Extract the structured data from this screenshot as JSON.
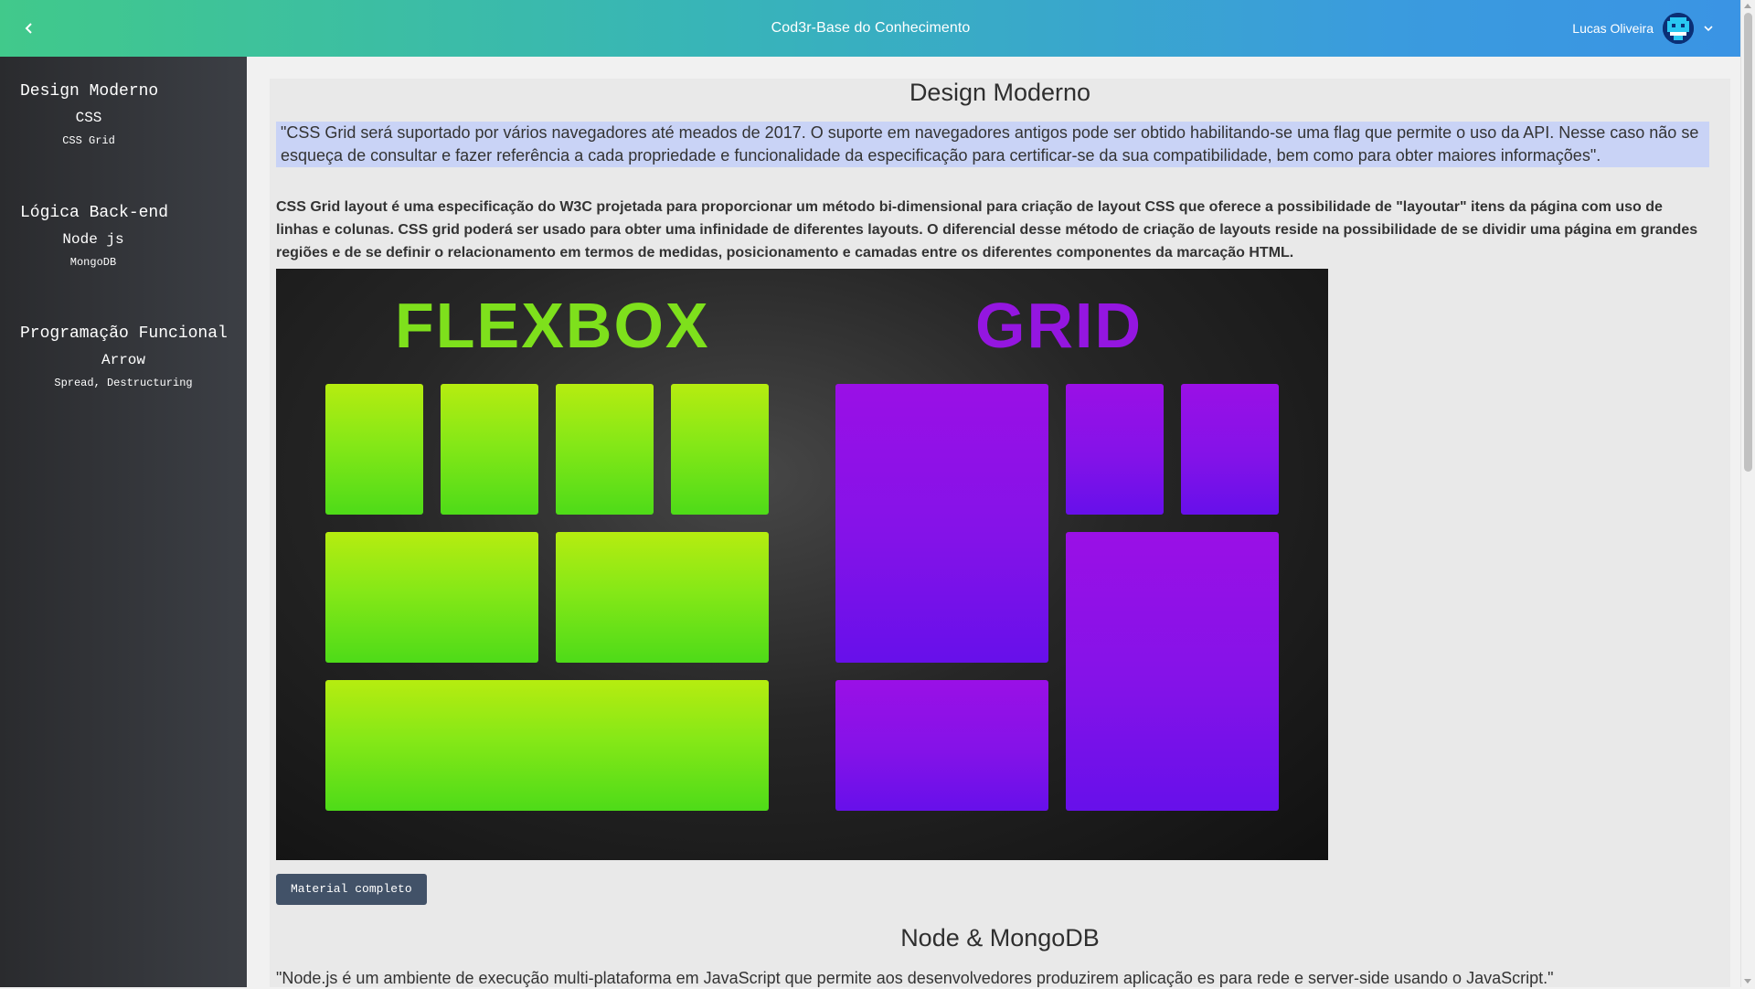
{
  "header": {
    "title": "Cod3r-Base do Conhecimento",
    "back_icon": "chevron-left-icon",
    "user_name": "Lucas Oliveira",
    "avatar_icon": "pixel-robot-avatar",
    "dropdown_icon": "chevron-down-icon"
  },
  "sidebar": {
    "groups": [
      {
        "label": "Design Moderno",
        "child": {
          "label": "CSS",
          "child": {
            "label": "CSS Grid"
          }
        }
      },
      {
        "label": "Lógica Back-end",
        "child": {
          "label": "Node js",
          "child": {
            "label": "MongoDB"
          }
        }
      },
      {
        "label": "Programação Funcional",
        "child": {
          "label": "Arrow",
          "child": {
            "label": "Spread, Destructuring"
          }
        }
      }
    ]
  },
  "article": {
    "title": "Design Moderno",
    "quote": "\"CSS Grid será suportado por vários navegadores até meados de 2017. O suporte em navegadores antigos pode ser obtido habilitando-se uma flag que permite o uso da API. Nesse caso não se esqueça de consultar e fazer referência a cada propriedade e funcionalidade da especificação para certificar-se da sua compatibilidade, bem como para obter maiores informações\".",
    "description": "CSS Grid layout é uma especificação do W3C projetada para proporcionar um método bi-dimensional para criação de layout CSS que oferece a possibilidade de \"layoutar\" itens da página com uso de linhas e colunas. CSS grid poderá ser usado para obter uma infinidade de diferentes layouts. O diferencial desse método de criação de layouts reside na possibilidade de se dividir uma página em grandes regiões e de se definir o relacionamento em termos de medidas, posicionamento e camadas entre os diferentes componentes da marcação HTML.",
    "image": {
      "left_word": "FLEXBOX",
      "right_word": "GRID",
      "left_color": "#7ee01c",
      "right_color": "#9416e0"
    },
    "button_label": "Material completo"
  },
  "next_article": {
    "title": "Node & MongoDB",
    "quote": "\"Node.js é um ambiente de execução multi-plataforma em JavaScript que permite aos desenvolvedores produzirem aplicação es para rede e server-side usando o JavaScript.\""
  }
}
